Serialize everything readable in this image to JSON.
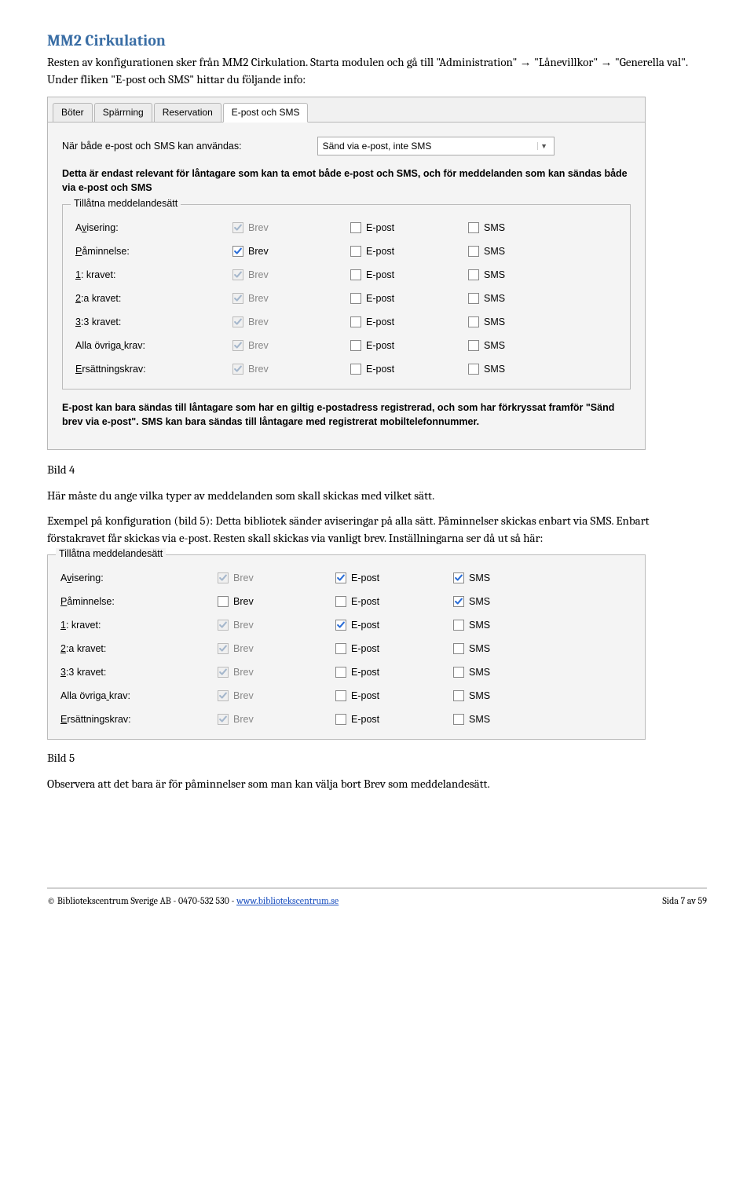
{
  "heading": "MM2 Cirkulation",
  "para1_a": "Resten av konfigurationen sker från MM2 Cirkulation. Starta modulen och gå till \"Administration\" ",
  "para1_b": " \"Lånevillkor\" ",
  "para1_c": " \"Generella val\". Under fliken \"E-post och SMS\" hittar du följande info:",
  "arrow": "→",
  "panel1": {
    "tabs": [
      "Böter",
      "Spärrning",
      "Reservation",
      "E-post och SMS"
    ],
    "dd_label": "När både e-post och SMS kan användas:",
    "dd_value": "Sänd via e-post, inte SMS",
    "bold1": "Detta är endast relevant för låntagare som kan ta emot både e-post och SMS, och för meddelanden som kan sändas både via e-post och SMS",
    "group_legend": "Tillåtna meddelandesätt",
    "cols": [
      "Brev",
      "E-post",
      "SMS"
    ],
    "rows": [
      {
        "label": "Avisering:",
        "ul": 1,
        "brev": {
          "checked": true,
          "disabled": true
        },
        "epost": {
          "checked": false,
          "disabled": false
        },
        "sms": {
          "checked": false,
          "disabled": false
        }
      },
      {
        "label": "Påminnelse:",
        "ul": 0,
        "brev": {
          "checked": true,
          "disabled": false
        },
        "epost": {
          "checked": false,
          "disabled": false
        },
        "sms": {
          "checked": false,
          "disabled": false
        }
      },
      {
        "label": "1: kravet:",
        "ul": 0,
        "brev": {
          "checked": true,
          "disabled": true
        },
        "epost": {
          "checked": false,
          "disabled": false
        },
        "sms": {
          "checked": false,
          "disabled": false
        }
      },
      {
        "label": "2:a kravet:",
        "ul": 0,
        "brev": {
          "checked": true,
          "disabled": true
        },
        "epost": {
          "checked": false,
          "disabled": false
        },
        "sms": {
          "checked": false,
          "disabled": false
        }
      },
      {
        "label": "3:3 kravet:",
        "ul": 0,
        "brev": {
          "checked": true,
          "disabled": true
        },
        "epost": {
          "checked": false,
          "disabled": false
        },
        "sms": {
          "checked": false,
          "disabled": false
        }
      },
      {
        "label": "Alla övriga krav:",
        "ul": 11,
        "brev": {
          "checked": true,
          "disabled": true
        },
        "epost": {
          "checked": false,
          "disabled": false
        },
        "sms": {
          "checked": false,
          "disabled": false
        }
      },
      {
        "label": "Ersättningskrav:",
        "ul": 0,
        "brev": {
          "checked": true,
          "disabled": true
        },
        "epost": {
          "checked": false,
          "disabled": false
        },
        "sms": {
          "checked": false,
          "disabled": false
        }
      }
    ],
    "bold2": "E-post kan bara sändas till låntagare som har en giltig e-postadress registrerad, och som har förkryssat framför \"Sänd brev via e-post\". SMS kan bara sändas till låntagare med registrerat mobiltelefonnummer."
  },
  "caption1": "Bild 4",
  "para2": "Här måste du ange vilka typer av meddelanden som skall skickas med vilket sätt.",
  "para3": "Exempel på konfiguration (bild 5): Detta bibliotek sänder aviseringar på alla sätt. Påminnelser skickas enbart via SMS. Enbart förstakravet får skickas via e-post. Resten skall skickas via vanligt brev. Inställningarna ser då ut så här:",
  "panel2": {
    "group_legend": "Tillåtna meddelandesätt",
    "cols": [
      "Brev",
      "E-post",
      "SMS"
    ],
    "rows": [
      {
        "label": "Avisering:",
        "ul": 1,
        "brev": {
          "checked": true,
          "disabled": true
        },
        "epost": {
          "checked": true,
          "disabled": false
        },
        "sms": {
          "checked": true,
          "disabled": false
        }
      },
      {
        "label": "Påminnelse:",
        "ul": 0,
        "brev": {
          "checked": false,
          "disabled": false
        },
        "epost": {
          "checked": false,
          "disabled": false
        },
        "sms": {
          "checked": true,
          "disabled": false
        }
      },
      {
        "label": "1: kravet:",
        "ul": 0,
        "brev": {
          "checked": true,
          "disabled": true
        },
        "epost": {
          "checked": true,
          "disabled": false
        },
        "sms": {
          "checked": false,
          "disabled": false
        }
      },
      {
        "label": "2:a kravet:",
        "ul": 0,
        "brev": {
          "checked": true,
          "disabled": true
        },
        "epost": {
          "checked": false,
          "disabled": false
        },
        "sms": {
          "checked": false,
          "disabled": false
        }
      },
      {
        "label": "3:3 kravet:",
        "ul": 0,
        "brev": {
          "checked": true,
          "disabled": true
        },
        "epost": {
          "checked": false,
          "disabled": false
        },
        "sms": {
          "checked": false,
          "disabled": false
        }
      },
      {
        "label": "Alla övriga krav:",
        "ul": 11,
        "brev": {
          "checked": true,
          "disabled": true
        },
        "epost": {
          "checked": false,
          "disabled": false
        },
        "sms": {
          "checked": false,
          "disabled": false
        }
      },
      {
        "label": "Ersättningskrav:",
        "ul": 0,
        "brev": {
          "checked": true,
          "disabled": true
        },
        "epost": {
          "checked": false,
          "disabled": false
        },
        "sms": {
          "checked": false,
          "disabled": false
        }
      }
    ]
  },
  "caption2": "Bild 5",
  "para4": "Observera att det bara är för påminnelser som man kan välja bort Brev som meddelandesätt.",
  "footer_left_a": "© Bibliotekscentrum Sverige AB - 0470-532 530 -  ",
  "footer_link": "www.bibliotekscentrum.se",
  "footer_right": "Sida 7 av 59"
}
